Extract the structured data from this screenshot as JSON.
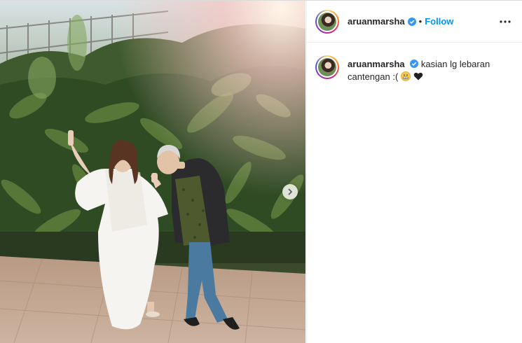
{
  "post": {
    "username": "aruanmarsha",
    "separator": "•",
    "follow_label": "Follow",
    "caption": {
      "username": "aruanmarsha",
      "text": "kasian lg lebaran cantengan :("
    }
  },
  "icons": {
    "verified": "verified-badge-icon",
    "more": "more-options-icon",
    "next": "chevron-right-icon",
    "emoji1": "grimacing-face-emoji",
    "emoji2": "black-heart-emoji"
  },
  "colors": {
    "link": "#0095f6",
    "text": "#262626",
    "border": "#efefef"
  }
}
